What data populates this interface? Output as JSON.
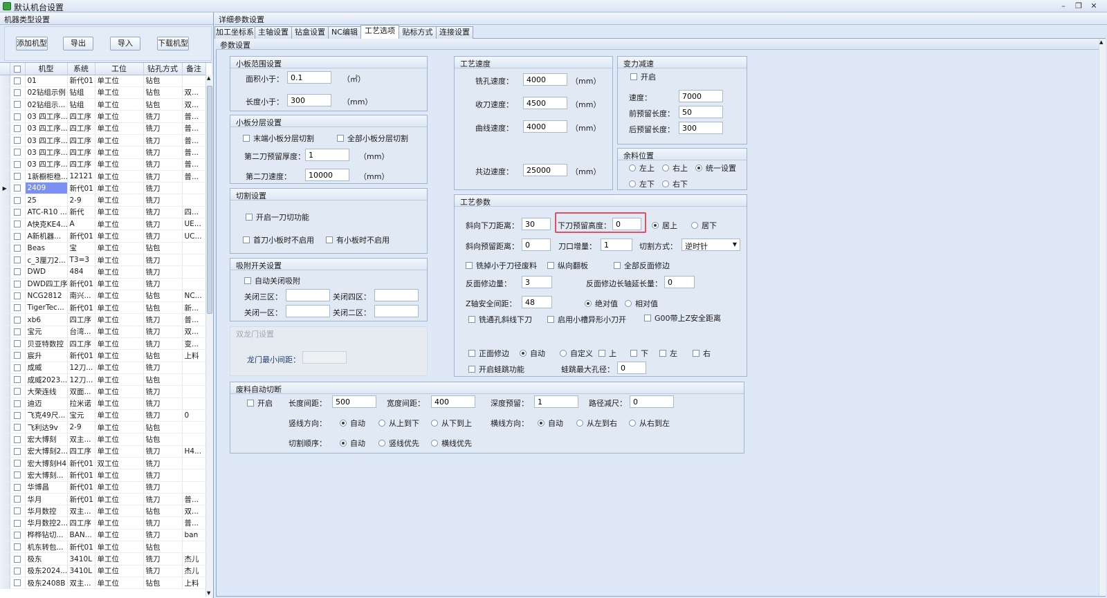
{
  "window": {
    "title": "默认机台设置"
  },
  "left": {
    "header": "机器类型设置",
    "buttons": [
      "添加机型",
      "导出",
      "导入",
      "下载机型"
    ],
    "columns": [
      "机型",
      "系统",
      "工位",
      "钻孔方式",
      "备注"
    ],
    "selected_row": 9,
    "rows": [
      [
        "01",
        "新代01",
        "单工位",
        "钻包",
        ""
      ],
      [
        "02钻组示例",
        "钻组",
        "单工位",
        "钻包",
        "双..."
      ],
      [
        "02钻组示...",
        "钻组",
        "单工位",
        "钻包",
        "双..."
      ],
      [
        "03 四工序...",
        "四工序",
        "单工位",
        "铣刀",
        "普..."
      ],
      [
        "03 四工序...",
        "四工序",
        "单工位",
        "铣刀",
        "普..."
      ],
      [
        "03 四工序...",
        "四工序",
        "单工位",
        "铣刀",
        "普..."
      ],
      [
        "03 四工序...",
        "四工序",
        "单工位",
        "铣刀",
        "普..."
      ],
      [
        "03 四工序...",
        "四工序",
        "单工位",
        "铣刀",
        "普..."
      ],
      [
        "1新橱柜稳...",
        "12121",
        "单工位",
        "铣刀",
        "普..."
      ],
      [
        "2409",
        "新代01",
        "单工位",
        "铣刀",
        ""
      ],
      [
        "25",
        "2-9",
        "单工位",
        "铣刀",
        ""
      ],
      [
        "ATC-R10 ...",
        "新代",
        "单工位",
        "铣刀",
        "四..."
      ],
      [
        "A快克KE4...",
        "A",
        "单工位",
        "铣刀",
        "UE..."
      ],
      [
        "A新机器...",
        "新代01",
        "单工位",
        "铣刀",
        "UC..."
      ],
      [
        "Beas",
        "宝",
        "单工位",
        "钻包",
        ""
      ],
      [
        "c_3厘刀2...",
        "T3=3",
        "单工位",
        "铣刀",
        ""
      ],
      [
        "DWD",
        "484",
        "单工位",
        "铣刀",
        ""
      ],
      [
        "DWD四工序",
        "新代01",
        "单工位",
        "铣刀",
        ""
      ],
      [
        "NCG2812",
        "南兴...",
        "单工位",
        "钻包",
        "NC..."
      ],
      [
        "TigerTec...",
        "新代01",
        "单工位",
        "钻包",
        "新..."
      ],
      [
        "xb6",
        "四工序",
        "单工位",
        "铣刀",
        "普..."
      ],
      [
        "宝元",
        "台湾...",
        "单工位",
        "铣刀",
        "双..."
      ],
      [
        "贝亚特数控",
        "四工序",
        "单工位",
        "铣刀",
        "变..."
      ],
      [
        "宸升",
        "新代01",
        "单工位",
        "钻包",
        "上料"
      ],
      [
        "成威",
        "12刀...",
        "单工位",
        "铣刀",
        ""
      ],
      [
        "成威2023...",
        "12刀...",
        "单工位",
        "钻包",
        ""
      ],
      [
        "大荣连线",
        "双面...",
        "单工位",
        "铣刀",
        ""
      ],
      [
        "迪迈",
        "拉米诺",
        "单工位",
        "铣刀",
        ""
      ],
      [
        "飞克49尺...",
        "宝元",
        "单工位",
        "铣刀",
        "0"
      ],
      [
        "飞利达9v",
        "2-9",
        "单工位",
        "钻包",
        ""
      ],
      [
        "宏大博刻",
        "双主...",
        "单工位",
        "钻包",
        ""
      ],
      [
        "宏大博刻2...",
        "四工序",
        "单工位",
        "铣刀",
        "H4..."
      ],
      [
        "宏大博刻H4",
        "新代01",
        "双工位",
        "铣刀",
        ""
      ],
      [
        "宏大博刻...",
        "新代01",
        "单工位",
        "铣刀",
        ""
      ],
      [
        "华博昌",
        "新代01",
        "单工位",
        "铣刀",
        ""
      ],
      [
        "华月",
        "新代01",
        "单工位",
        "铣刀",
        "普..."
      ],
      [
        "华月数控",
        "双主...",
        "单工位",
        "钻包",
        "双..."
      ],
      [
        "华月数控2...",
        "四工序",
        "单工位",
        "铣刀",
        "普..."
      ],
      [
        "桦桦钻切...",
        "BAN...",
        "单工位",
        "铣刀",
        "ban"
      ],
      [
        "机东转包...",
        "新代01",
        "单工位",
        "钻包",
        ""
      ],
      [
        "极东",
        "3410L",
        "单工位",
        "铣刀",
        "杰儿"
      ],
      [
        "极东2024...",
        "3410L",
        "单工位",
        "铣刀",
        "杰儿"
      ],
      [
        "极东2408B",
        "双主...",
        "单工位",
        "钻包",
        "上料"
      ]
    ]
  },
  "right": {
    "header": "详细参数设置",
    "tabs": [
      "加工坐标系",
      "主轴设置",
      "钻盒设置",
      "NC编辑",
      "工艺选项",
      "贴标方式",
      "连接设置"
    ],
    "active_tab": 4,
    "subheader": "参数设置",
    "small_board": {
      "title": "小板范围设置",
      "area_label": "面积小于：",
      "area_value": "0.1",
      "area_unit": "（㎡）",
      "len_label": "长度小于：",
      "len_value": "300",
      "len_unit": "（mm）"
    },
    "layer": {
      "title": "小板分层设置",
      "chk1": "末端小板分层切割",
      "chk2": "全部小板分层切割",
      "thick_label": "第二刀预留厚度：",
      "thick_value": "1",
      "thick_unit": "（mm）",
      "speed_label": "第二刀速度：",
      "speed_value": "10000",
      "speed_unit": "（mm）"
    },
    "cut": {
      "title": "切割设置",
      "chk1": "开启一刀切功能",
      "chk2": "首刀小板时不启用",
      "chk3": "有小板时不启用"
    },
    "vacuum": {
      "title": "吸附开关设置",
      "chk": "自动关闭吸附",
      "l3": "关闭三区：",
      "l4": "关闭四区：",
      "l1": "关闭一区：",
      "l2": "关闭二区："
    },
    "gantry": {
      "title": "双龙门设置",
      "label": "龙门最小间距："
    },
    "speed": {
      "title": "工艺速度",
      "mill_label": "铣孔速度：",
      "mill_value": "4000",
      "ret_label": "收刀速度：",
      "ret_value": "4500",
      "curve_label": "曲线速度：",
      "curve_value": "4000",
      "common_label": "共边速度：",
      "common_value": "25000",
      "unit": "（mm）"
    },
    "decel": {
      "title": "变力减速",
      "chk": "开启",
      "speed_label": "速度：",
      "speed_value": "7000",
      "front_label": "前预留长度：",
      "front_value": "50",
      "back_label": "后预留长度：",
      "back_value": "300"
    },
    "remnant": {
      "title": "余料位置",
      "opts": [
        "左上",
        "右上",
        "统一设置",
        "左下",
        "右下"
      ],
      "selected": 2
    },
    "params": {
      "title": "工艺参数",
      "slant_label": "斜向下刀距离：",
      "slant_value": "30",
      "drop_label": "下刀预留高度：",
      "drop_value": "0",
      "pos_opts": [
        "居上",
        "居下"
      ],
      "pos_selected": 0,
      "slant_res_label": "斜向预留距离：",
      "slant_res_value": "0",
      "edge_label": "刀口增量：",
      "edge_value": "1",
      "mode_label": "切割方式：",
      "mode_value": "逆时针",
      "chk1": "铣掉小于刀径废料",
      "chk2": "纵向翻板",
      "chk3": "全部反面修边",
      "rev_label": "反面修边量：",
      "rev_value": "3",
      "rev_ext_label": "反面修边长轴延长量：",
      "rev_ext_value": "0",
      "z_label": "Z轴安全间距：",
      "z_value": "48",
      "z_opts": [
        "绝对值",
        "相对值"
      ],
      "z_selected": 0,
      "chk4": "铣通孔斜线下刀",
      "chk5": "启用小槽异形小刀开",
      "chk6": "G00带上Z安全距离",
      "chk7": "正面修边",
      "front_opts": [
        "自动",
        "自定义"
      ],
      "front_selected": 0,
      "dirs": [
        "上",
        "下",
        "左",
        "右"
      ],
      "chk8": "开启蛙跳功能",
      "hop_label": "蛙跳最大孔径：",
      "hop_value": "0"
    },
    "scrap": {
      "title": "废料自动切断",
      "chk": "开启",
      "len_label": "长度间距：",
      "len_value": "500",
      "wid_label": "宽度间距：",
      "wid_value": "400",
      "depth_label": "深度预留：",
      "depth_value": "1",
      "path_label": "路径减尺：",
      "path_value": "0",
      "v_label": "竖线方向：",
      "v_opts": [
        "自动",
        "从上到下",
        "从下到上"
      ],
      "v_selected": 0,
      "h_label": "横线方向：",
      "h_opts": [
        "自动",
        "从左到右",
        "从右到左"
      ],
      "h_selected": 0,
      "order_label": "切割顺序：",
      "order_opts": [
        "自动",
        "竖线优先",
        "横线优先"
      ],
      "order_selected": 0
    }
  }
}
